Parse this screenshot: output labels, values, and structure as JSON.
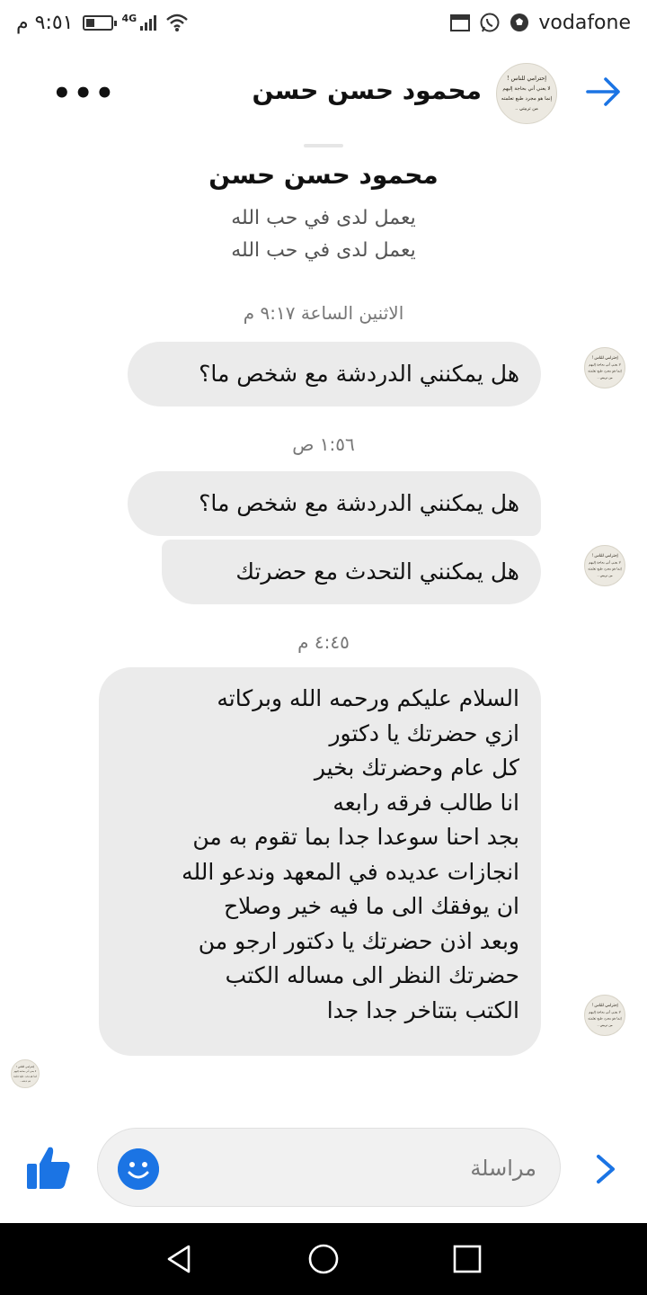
{
  "status_bar": {
    "time": "٩:٥١ م",
    "network": "4G",
    "carrier": "vodafone",
    "battery_level": 0.35
  },
  "header": {
    "contact_name": "محمود حسن حسن",
    "more_label": "•••"
  },
  "profile": {
    "name": "محمود حسن حسن",
    "line1": "يعمل لدى في حب الله",
    "line2": "يعمل لدى في حب الله"
  },
  "avatar_text": {
    "line1": "إحترامي للناس !",
    "line2": "لا يعني أني بحاجة إليهم",
    "line3": "إنما هو مجرد طبع تعلمته",
    "line4": "من تربيتي .."
  },
  "conversation": {
    "ts1": "الاثنين الساعة ٩:١٧ م",
    "msg1": "هل يمكنني الدردشة مع شخص ما؟",
    "ts2": "١:٥٦ ص",
    "msg2": "هل يمكنني الدردشة مع شخص ما؟",
    "msg3": "هل يمكنني التحدث مع حضرتك",
    "ts3": "٤:٤٥ م",
    "msg4": "السلام عليكم ورحمه الله وبركاته\nازي حضرتك يا دكتور\nكل عام وحضرتك بخير\nانا طالب فرقه رابعه\nبجد احنا سوعدا جدا بما تقوم به من\nانجازات عديده في المعهد وندعو الله\nان يوفقك الى ما فيه خير وصلاح\nوبعد اذن حضرتك يا دكتور ارجو من\nحضرتك النظر الى مساله الكتب\nالكتب بتتاخر جدا جدا"
  },
  "composer": {
    "placeholder": "مراسلة"
  },
  "colors": {
    "accent": "#1b74e4",
    "bubble": "#ebebeb",
    "nav_bar": "#000000"
  },
  "icons": {
    "back": "back-arrow-icon",
    "more": "more-icon",
    "like": "thumbs-up-icon",
    "emoji": "emoji-icon",
    "send": "chevron-right-icon",
    "nav_back": "nav-back-icon",
    "nav_home": "nav-home-icon",
    "nav_recents": "nav-recents-icon"
  }
}
